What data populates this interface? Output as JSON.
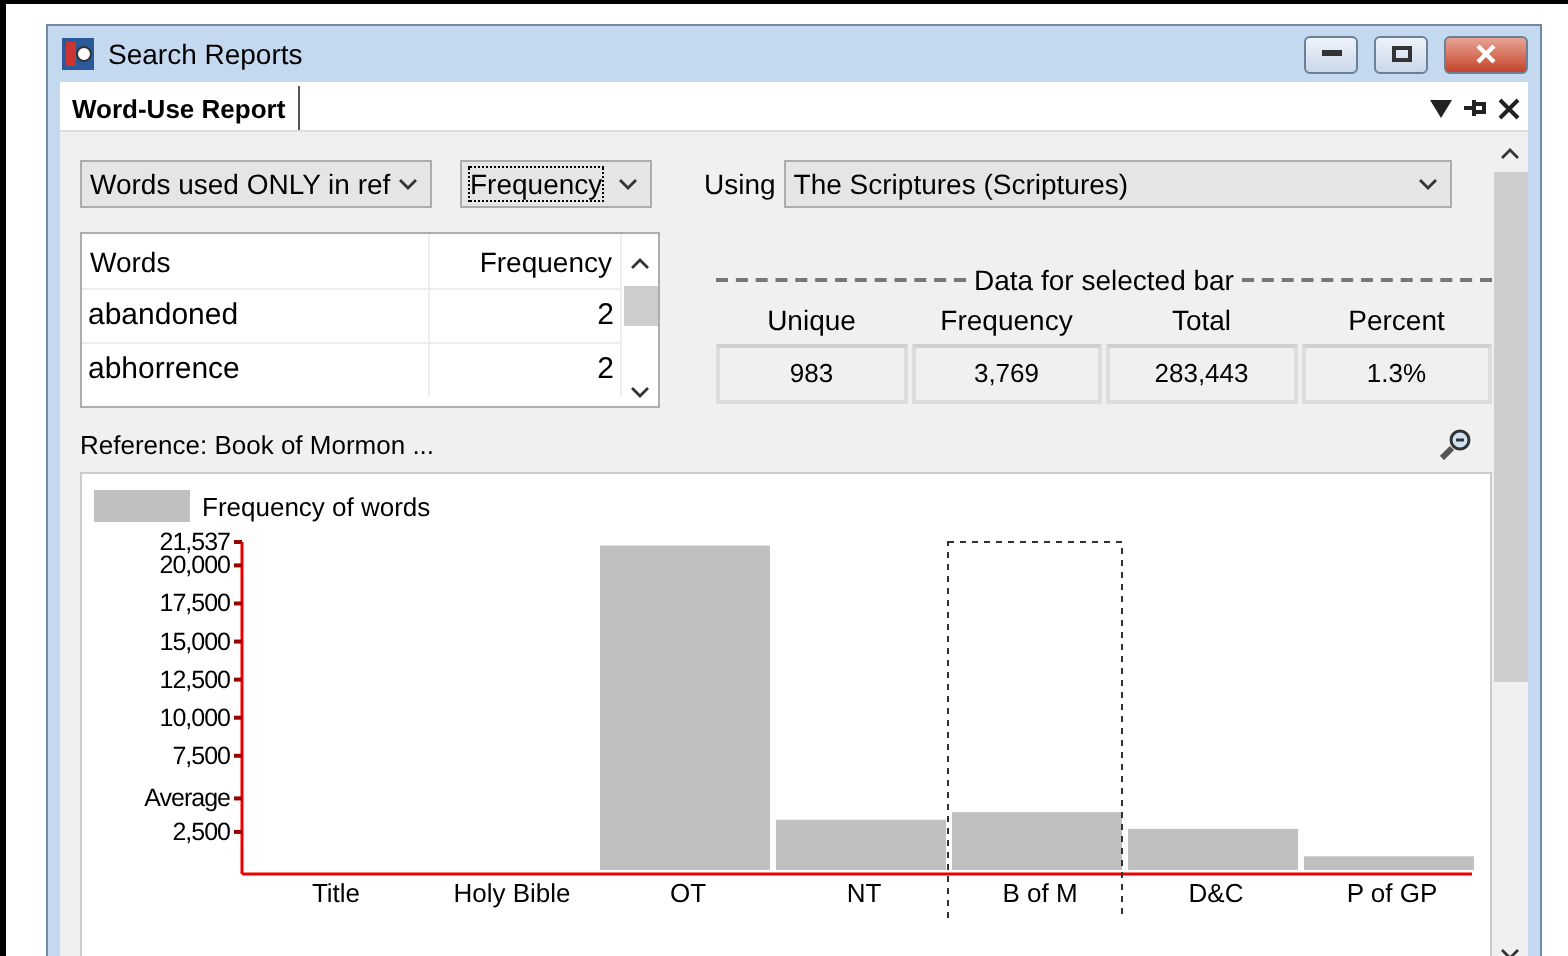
{
  "window": {
    "title": "Search Reports"
  },
  "tabs": [
    {
      "label": "Word-Use Report",
      "selected": true
    }
  ],
  "filter_dropdown": {
    "value": "Words used ONLY in ref"
  },
  "sort_dropdown": {
    "value": "Frequency",
    "focused": true
  },
  "using": {
    "label": "Using",
    "value": "The Scriptures (Scriptures)"
  },
  "word_list": {
    "columns": [
      "Words",
      "Frequency"
    ],
    "rows": [
      {
        "word": "abandoned",
        "frequency": "2"
      },
      {
        "word": "abhorrence",
        "frequency": "2"
      }
    ]
  },
  "selected_bar_data": {
    "title": "Data for selected bar",
    "fields": [
      {
        "label": "Unique",
        "value": "983"
      },
      {
        "label": "Frequency",
        "value": "3,769"
      },
      {
        "label": "Total",
        "value": "283,443"
      },
      {
        "label": "Percent",
        "value": "1.3%"
      }
    ]
  },
  "reference": {
    "label": "Reference: Book of Mormon ..."
  },
  "chart_data": {
    "type": "bar",
    "categories": [
      "Title",
      "Holy Bible",
      "OT",
      "NT",
      "B of M",
      "D&C",
      "P of GP"
    ],
    "series": [
      {
        "name": "Frequency of words",
        "color": "#c0c0c0",
        "values": [
          0,
          0,
          21300,
          3300,
          3800,
          2700,
          900
        ]
      }
    ],
    "ylim": [
      0,
      21537
    ],
    "yticks": [
      {
        "value": 2500,
        "label": "2,500"
      },
      {
        "value": 4700,
        "label": "Average"
      },
      {
        "value": 7500,
        "label": "7,500"
      },
      {
        "value": 10000,
        "label": "10,000"
      },
      {
        "value": 12500,
        "label": "12,500"
      },
      {
        "value": 15000,
        "label": "15,000"
      },
      {
        "value": 17500,
        "label": "17,500"
      },
      {
        "value": 20000,
        "label": "20,000"
      },
      {
        "value": 21537,
        "label": "21,537"
      }
    ],
    "annotations": [
      {
        "x": "B of M"
      }
    ]
  }
}
